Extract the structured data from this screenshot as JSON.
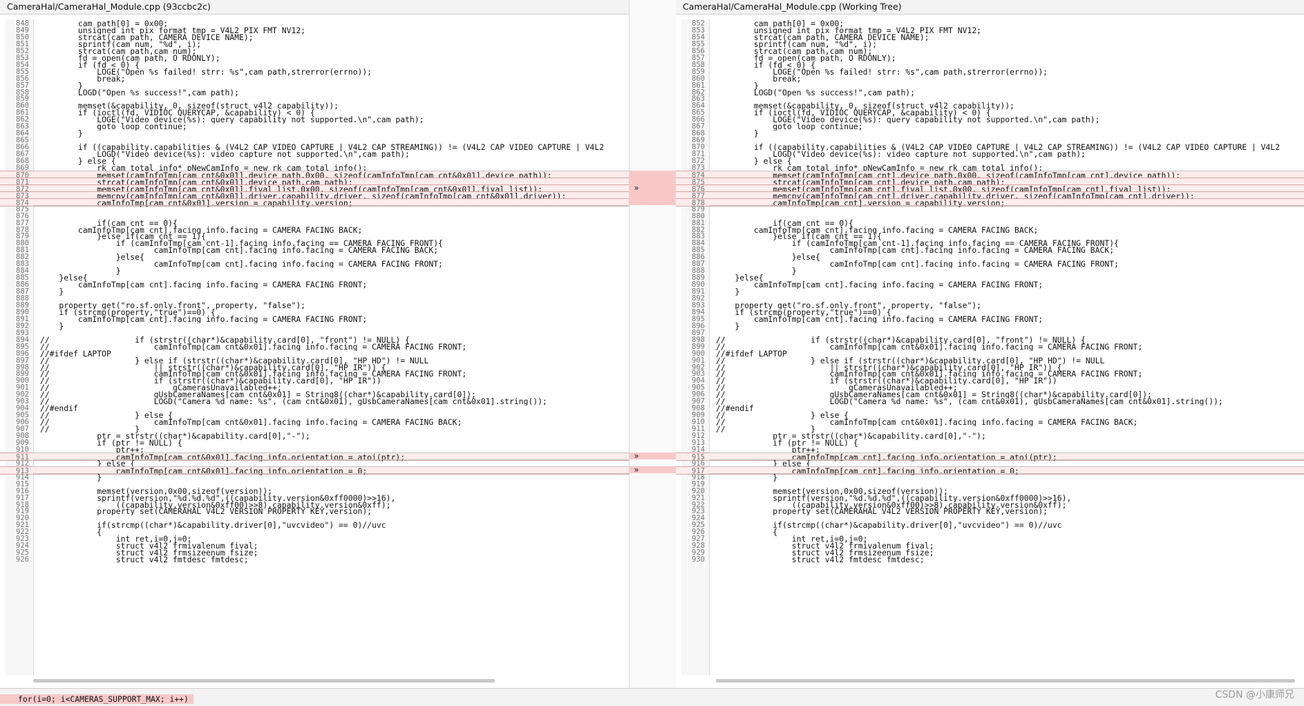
{
  "left": {
    "title": "CameraHal/CameraHal_Module.cpp (93ccbc2c)",
    "lines": [
      {
        "n": "848",
        "t": "        cam_path[0] = 0x00;"
      },
      {
        "n": "849",
        "t": "        unsigned int pix_format_tmp = V4L2_PIX_FMT_NV12;"
      },
      {
        "n": "850",
        "t": "        strcat(cam_path, CAMERA_DEVICE_NAME);"
      },
      {
        "n": "851",
        "t": "        sprintf(cam_num, \"%d\", i);"
      },
      {
        "n": "852",
        "t": "        strcat(cam_path,cam_num);"
      },
      {
        "n": "853",
        "t": "        fd = open(cam_path, O_RDONLY);"
      },
      {
        "n": "854",
        "t": "        if (fd < 0) {"
      },
      {
        "n": "855",
        "t": "            LOGE(\"Open %s failed! strr: %s\",cam_path,strerror(errno));"
      },
      {
        "n": "856",
        "t": "            break;"
      },
      {
        "n": "857",
        "t": "        }"
      },
      {
        "n": "858",
        "t": "        LOGD(\"Open %s success!\",cam_path);"
      },
      {
        "n": "859",
        "t": ""
      },
      {
        "n": "860",
        "t": "        memset(&capability, 0, sizeof(struct v4l2_capability));"
      },
      {
        "n": "861",
        "t": "        if (ioctl(fd, VIDIOC_QUERYCAP, &capability) < 0) {"
      },
      {
        "n": "862",
        "t": "            LOGE(\"Video device(%s): query capability not supported.\\n\",cam_path);"
      },
      {
        "n": "863",
        "t": "            goto loop_continue;"
      },
      {
        "n": "864",
        "t": "        }"
      },
      {
        "n": "865",
        "t": ""
      },
      {
        "n": "866",
        "t": "        if ((capability.capabilities & (V4L2_CAP_VIDEO_CAPTURE | V4L2_CAP_STREAMING)) != (V4L2_CAP_VIDEO_CAPTURE | V4L2"
      },
      {
        "n": "867",
        "t": "            LOGD(\"Video device(%s): video capture not supported.\\n\",cam_path);"
      },
      {
        "n": "868",
        "t": "        } else {"
      },
      {
        "n": "869",
        "t": "            rk_cam_total_info* pNewCamInfo = new rk_cam_total_info();"
      },
      {
        "n": "870",
        "t": "            memset(camInfoTmp[cam_cnt&0x01].device_path,0x00, sizeof(camInfoTmp[cam_cnt&0x01].device_path));",
        "c": true
      },
      {
        "n": "871",
        "t": "            strcat(camInfoTmp[cam_cnt&0x01].device_path,cam_path);",
        "c": true
      },
      {
        "n": "872",
        "t": "            memset(camInfoTmp[cam_cnt&0x01].fival_list,0x00, sizeof(camInfoTmp[cam_cnt&0x01].fival_list));",
        "c": true
      },
      {
        "n": "873",
        "t": "            memcpy(camInfoTmp[cam_cnt&0x01].driver,capability.driver, sizeof(camInfoTmp[cam_cnt&0x01].driver));",
        "c": true
      },
      {
        "n": "874",
        "t": "            camInfoTmp[cam_cnt&0x01].version = capability.version;",
        "c": true
      },
      {
        "n": "875",
        "t": ""
      },
      {
        "n": "876",
        "t": ""
      },
      {
        "n": "877",
        "t": "            if(cam_cnt == 0){"
      },
      {
        "n": "878",
        "t": "        camInfoTmp[cam_cnt].facing_info.facing = CAMERA_FACING_BACK;"
      },
      {
        "n": "879",
        "t": "            }else if(cam_cnt == 1){"
      },
      {
        "n": "880",
        "t": "                if (camInfoTmp[cam_cnt-1].facing_info.facing == CAMERA_FACING_FRONT){"
      },
      {
        "n": "881",
        "t": "                        camInfoTmp[cam_cnt].facing_info.facing = CAMERA_FACING_BACK;"
      },
      {
        "n": "882",
        "t": "                }else{"
      },
      {
        "n": "883",
        "t": "                        camInfoTmp[cam_cnt].facing_info.facing = CAMERA_FACING_FRONT;"
      },
      {
        "n": "884",
        "t": "                }"
      },
      {
        "n": "885",
        "t": "    }else{"
      },
      {
        "n": "886",
        "t": "        camInfoTmp[cam_cnt].facing_info.facing = CAMERA_FACING_FRONT;"
      },
      {
        "n": "887",
        "t": "    }"
      },
      {
        "n": "888",
        "t": ""
      },
      {
        "n": "889",
        "t": "    property_get(\"ro.sf.only.front\", property, \"false\");"
      },
      {
        "n": "890",
        "t": "    if (strcmp(property,\"true\")==0) {"
      },
      {
        "n": "891",
        "t": "        camInfoTmp[cam_cnt].facing_info.facing = CAMERA_FACING_FRONT;"
      },
      {
        "n": "892",
        "t": "    }"
      },
      {
        "n": "893",
        "t": ""
      },
      {
        "n": "894",
        "t": "//                  if (strstr((char*)&capability.card[0], \"front\") != NULL) {"
      },
      {
        "n": "895",
        "t": "//                      camInfoTmp[cam_cnt&0x01].facing_info.facing = CAMERA_FACING_FRONT;"
      },
      {
        "n": "896",
        "t": "//#ifdef LAPTOP"
      },
      {
        "n": "897",
        "t": "//                  } else if (strstr((char*)&capability.card[0], \"HP HD\") != NULL"
      },
      {
        "n": "898",
        "t": "//                      || strstr((char*)&capability.card[0], \"HP IR\")) {"
      },
      {
        "n": "899",
        "t": "//                      camInfoTmp[cam_cnt&0x01].facing_info.facing = CAMERA_FACING_FRONT;"
      },
      {
        "n": "900",
        "t": "//                      if (strstr((char*)&capability.card[0], \"HP IR\"))"
      },
      {
        "n": "901",
        "t": "//                          gCamerasUnavailabled++;"
      },
      {
        "n": "902",
        "t": "//                      gUsbCameraNames[cam_cnt&0x01] = String8((char*)&capability.card[0]);"
      },
      {
        "n": "903",
        "t": "//                      LOGD(\"Camera %d name: %s\", (cam_cnt&0x01), gUsbCameraNames[cam_cnt&0x01].string());"
      },
      {
        "n": "904",
        "t": "//#endif"
      },
      {
        "n": "905",
        "t": "//                  } else {"
      },
      {
        "n": "906",
        "t": "//                      camInfoTmp[cam_cnt&0x01].facing_info.facing = CAMERA_FACING_BACK;"
      },
      {
        "n": "907",
        "t": "//                  }"
      },
      {
        "n": "908",
        "t": "            ptr = strstr((char*)&capability.card[0],\"-\");"
      },
      {
        "n": "909",
        "t": "            if (ptr != NULL) {"
      },
      {
        "n": "910",
        "t": "                ptr++;"
      },
      {
        "n": "911",
        "t": "                camInfoTmp[cam_cnt&0x01].facing_info.orientation = atoi(ptr);",
        "c": true
      },
      {
        "n": "912",
        "t": "            } else {"
      },
      {
        "n": "913",
        "t": "                camInfoTmp[cam_cnt&0x01].facing_info.orientation = 0;",
        "c": true
      },
      {
        "n": "914",
        "t": "            }"
      },
      {
        "n": "915",
        "t": ""
      },
      {
        "n": "916",
        "t": "            memset(version,0x00,sizeof(version));"
      },
      {
        "n": "917",
        "t": "            sprintf(version,\"%d.%d.%d\",((capability.version&0xff0000)>>16),"
      },
      {
        "n": "918",
        "t": "                ((capability.version&0xff00)>>8),capability.version&0xff);"
      },
      {
        "n": "919",
        "t": "            property_set(CAMERAHAL_V4L2_VERSION_PROPERTY_KEY,version);"
      },
      {
        "n": "920",
        "t": ""
      },
      {
        "n": "921",
        "t": "            if(strcmp((char*)&capability.driver[0],\"uvcvideo\") == 0)//uvc"
      },
      {
        "n": "922",
        "t": "            {"
      },
      {
        "n": "923",
        "t": "                int ret,i=0,j=0;"
      },
      {
        "n": "924",
        "t": "                struct v4l2_frmivalenum fival;"
      },
      {
        "n": "925",
        "t": "                struct v4l2_frmsizeenum fsize;"
      },
      {
        "n": "926",
        "t": "                struct v4l2_fmtdesc fmtdesc;"
      }
    ]
  },
  "right": {
    "title": "CameraHal/CameraHal_Module.cpp (Working Tree)",
    "lines": [
      {
        "n": "852",
        "t": "        cam_path[0] = 0x00;"
      },
      {
        "n": "853",
        "t": "        unsigned int pix_format_tmp = V4L2_PIX_FMT_NV12;"
      },
      {
        "n": "854",
        "t": "        strcat(cam_path, CAMERA_DEVICE_NAME);"
      },
      {
        "n": "855",
        "t": "        sprintf(cam_num, \"%d\", i);"
      },
      {
        "n": "856",
        "t": "        strcat(cam_path,cam_num);"
      },
      {
        "n": "857",
        "t": "        fd = open(cam_path, O_RDONLY);"
      },
      {
        "n": "858",
        "t": "        if (fd < 0) {"
      },
      {
        "n": "859",
        "t": "            LOGE(\"Open %s failed! strr: %s\",cam_path,strerror(errno));"
      },
      {
        "n": "860",
        "t": "            break;"
      },
      {
        "n": "861",
        "t": "        }"
      },
      {
        "n": "862",
        "t": "        LOGD(\"Open %s success!\",cam_path);"
      },
      {
        "n": "863",
        "t": ""
      },
      {
        "n": "864",
        "t": "        memset(&capability, 0, sizeof(struct v4l2_capability));"
      },
      {
        "n": "865",
        "t": "        if (ioctl(fd, VIDIOC_QUERYCAP, &capability) < 0) {"
      },
      {
        "n": "866",
        "t": "            LOGE(\"Video device(%s): query capability not supported.\\n\",cam_path);"
      },
      {
        "n": "867",
        "t": "            goto loop_continue;"
      },
      {
        "n": "868",
        "t": "        }"
      },
      {
        "n": "869",
        "t": ""
      },
      {
        "n": "870",
        "t": "        if ((capability.capabilities & (V4L2_CAP_VIDEO_CAPTURE | V4L2_CAP_STREAMING)) != (V4L2_CAP_VIDEO_CAPTURE | V4L2"
      },
      {
        "n": "871",
        "t": "            LOGD(\"Video device(%s): video capture not supported.\\n\",cam_path);"
      },
      {
        "n": "872",
        "t": "        } else {"
      },
      {
        "n": "873",
        "t": "            rk_cam_total_info* pNewCamInfo = new rk_cam_total_info();"
      },
      {
        "n": "874",
        "t": "            memset(camInfoTmp[cam_cnt].device_path,0x00, sizeof(camInfoTmp[cam_cnt].device_path));",
        "c": true
      },
      {
        "n": "875",
        "t": "            strcat(camInfoTmp[cam_cnt].device_path,cam_path);",
        "c": true
      },
      {
        "n": "876",
        "t": "            memset(camInfoTmp[cam_cnt].fival_list,0x00, sizeof(camInfoTmp[cam_cnt].fival_list));",
        "c": true
      },
      {
        "n": "877",
        "t": "            memcpy(camInfoTmp[cam_cnt].driver,capability.driver, sizeof(camInfoTmp[cam_cnt].driver));",
        "c": true
      },
      {
        "n": "878",
        "t": "            camInfoTmp[cam_cnt].version = capability.version;",
        "c": true
      },
      {
        "n": "879",
        "t": ""
      },
      {
        "n": "880",
        "t": ""
      },
      {
        "n": "881",
        "t": "            if(cam_cnt == 0){"
      },
      {
        "n": "882",
        "t": "        camInfoTmp[cam_cnt].facing_info.facing = CAMERA_FACING_BACK;"
      },
      {
        "n": "883",
        "t": "            }else if(cam_cnt == 1){"
      },
      {
        "n": "884",
        "t": "                if (camInfoTmp[cam_cnt-1].facing_info.facing == CAMERA_FACING_FRONT){"
      },
      {
        "n": "885",
        "t": "                        camInfoTmp[cam_cnt].facing_info.facing = CAMERA_FACING_BACK;"
      },
      {
        "n": "886",
        "t": "                }else{"
      },
      {
        "n": "887",
        "t": "                        camInfoTmp[cam_cnt].facing_info.facing = CAMERA_FACING_FRONT;"
      },
      {
        "n": "888",
        "t": "                }"
      },
      {
        "n": "889",
        "t": "    }else{"
      },
      {
        "n": "890",
        "t": "        camInfoTmp[cam_cnt].facing_info.facing = CAMERA_FACING_FRONT;"
      },
      {
        "n": "891",
        "t": "    }"
      },
      {
        "n": "892",
        "t": ""
      },
      {
        "n": "893",
        "t": "    property_get(\"ro.sf.only.front\", property, \"false\");"
      },
      {
        "n": "894",
        "t": "    if (strcmp(property,\"true\")==0) {"
      },
      {
        "n": "895",
        "t": "        camInfoTmp[cam_cnt].facing_info.facing = CAMERA_FACING_FRONT;"
      },
      {
        "n": "896",
        "t": "    }"
      },
      {
        "n": "897",
        "t": ""
      },
      {
        "n": "898",
        "t": "//                  if (strstr((char*)&capability.card[0], \"front\") != NULL) {"
      },
      {
        "n": "899",
        "t": "//                      camInfoTmp[cam_cnt&0x01].facing_info.facing = CAMERA_FACING_FRONT;"
      },
      {
        "n": "900",
        "t": "//#ifdef LAPTOP"
      },
      {
        "n": "901",
        "t": "//                  } else if (strstr((char*)&capability.card[0], \"HP HD\") != NULL"
      },
      {
        "n": "902",
        "t": "//                      || strstr((char*)&capability.card[0], \"HP IR\")) {"
      },
      {
        "n": "903",
        "t": "//                      camInfoTmp[cam_cnt&0x01].facing_info.facing = CAMERA_FACING_FRONT;"
      },
      {
        "n": "904",
        "t": "//                      if (strstr((char*)&capability.card[0], \"HP IR\"))"
      },
      {
        "n": "905",
        "t": "//                          gCamerasUnavailabled++;"
      },
      {
        "n": "906",
        "t": "//                      gUsbCameraNames[cam_cnt&0x01] = String8((char*)&capability.card[0]);"
      },
      {
        "n": "907",
        "t": "//                      LOGD(\"Camera %d name: %s\", (cam_cnt&0x01), gUsbCameraNames[cam_cnt&0x01].string());"
      },
      {
        "n": "908",
        "t": "//#endif"
      },
      {
        "n": "909",
        "t": "//                  } else {"
      },
      {
        "n": "910",
        "t": "//                      camInfoTmp[cam_cnt&0x01].facing_info.facing = CAMERA_FACING_BACK;"
      },
      {
        "n": "911",
        "t": "//                  }"
      },
      {
        "n": "912",
        "t": "            ptr = strstr((char*)&capability.card[0],\"-\");"
      },
      {
        "n": "913",
        "t": "            if (ptr != NULL) {"
      },
      {
        "n": "914",
        "t": "                ptr++;"
      },
      {
        "n": "915",
        "t": "                camInfoTmp[cam_cnt].facing_info.orientation = atoi(ptr);",
        "c": true
      },
      {
        "n": "916",
        "t": "            } else {"
      },
      {
        "n": "917",
        "t": "                camInfoTmp[cam_cnt].facing_info.orientation = 0;",
        "c": true
      },
      {
        "n": "918",
        "t": "            }"
      },
      {
        "n": "919",
        "t": ""
      },
      {
        "n": "920",
        "t": "            memset(version,0x00,sizeof(version));"
      },
      {
        "n": "921",
        "t": "            sprintf(version,\"%d.%d.%d\",((capability.version&0xff0000)>>16),"
      },
      {
        "n": "922",
        "t": "                ((capability.version&0xff00)>>8),capability.version&0xff);"
      },
      {
        "n": "923",
        "t": "            property_set(CAMERAHAL_V4L2_VERSION_PROPERTY_KEY,version);"
      },
      {
        "n": "924",
        "t": ""
      },
      {
        "n": "925",
        "t": "            if(strcmp((char*)&capability.driver[0],\"uvcvideo\") == 0)//uvc"
      },
      {
        "n": "926",
        "t": "            {"
      },
      {
        "n": "927",
        "t": "                int ret,i=0,j=0;"
      },
      {
        "n": "928",
        "t": "                struct v4l2_frmivalenum fival;"
      },
      {
        "n": "929",
        "t": "                struct v4l2_frmsizeenum fsize;"
      },
      {
        "n": "930",
        "t": "                struct v4l2_fmtdesc fmtdesc;"
      }
    ]
  },
  "diff": {
    "arrow": "»",
    "changed_hunks": [
      [
        22,
        26
      ],
      [
        63,
        63
      ],
      [
        65,
        65
      ]
    ]
  },
  "bottom": {
    "code": "for(i=0; i<CAMERAS_SUPPORT_MAX; i++)"
  },
  "watermark": "CSDN @小康师兄"
}
